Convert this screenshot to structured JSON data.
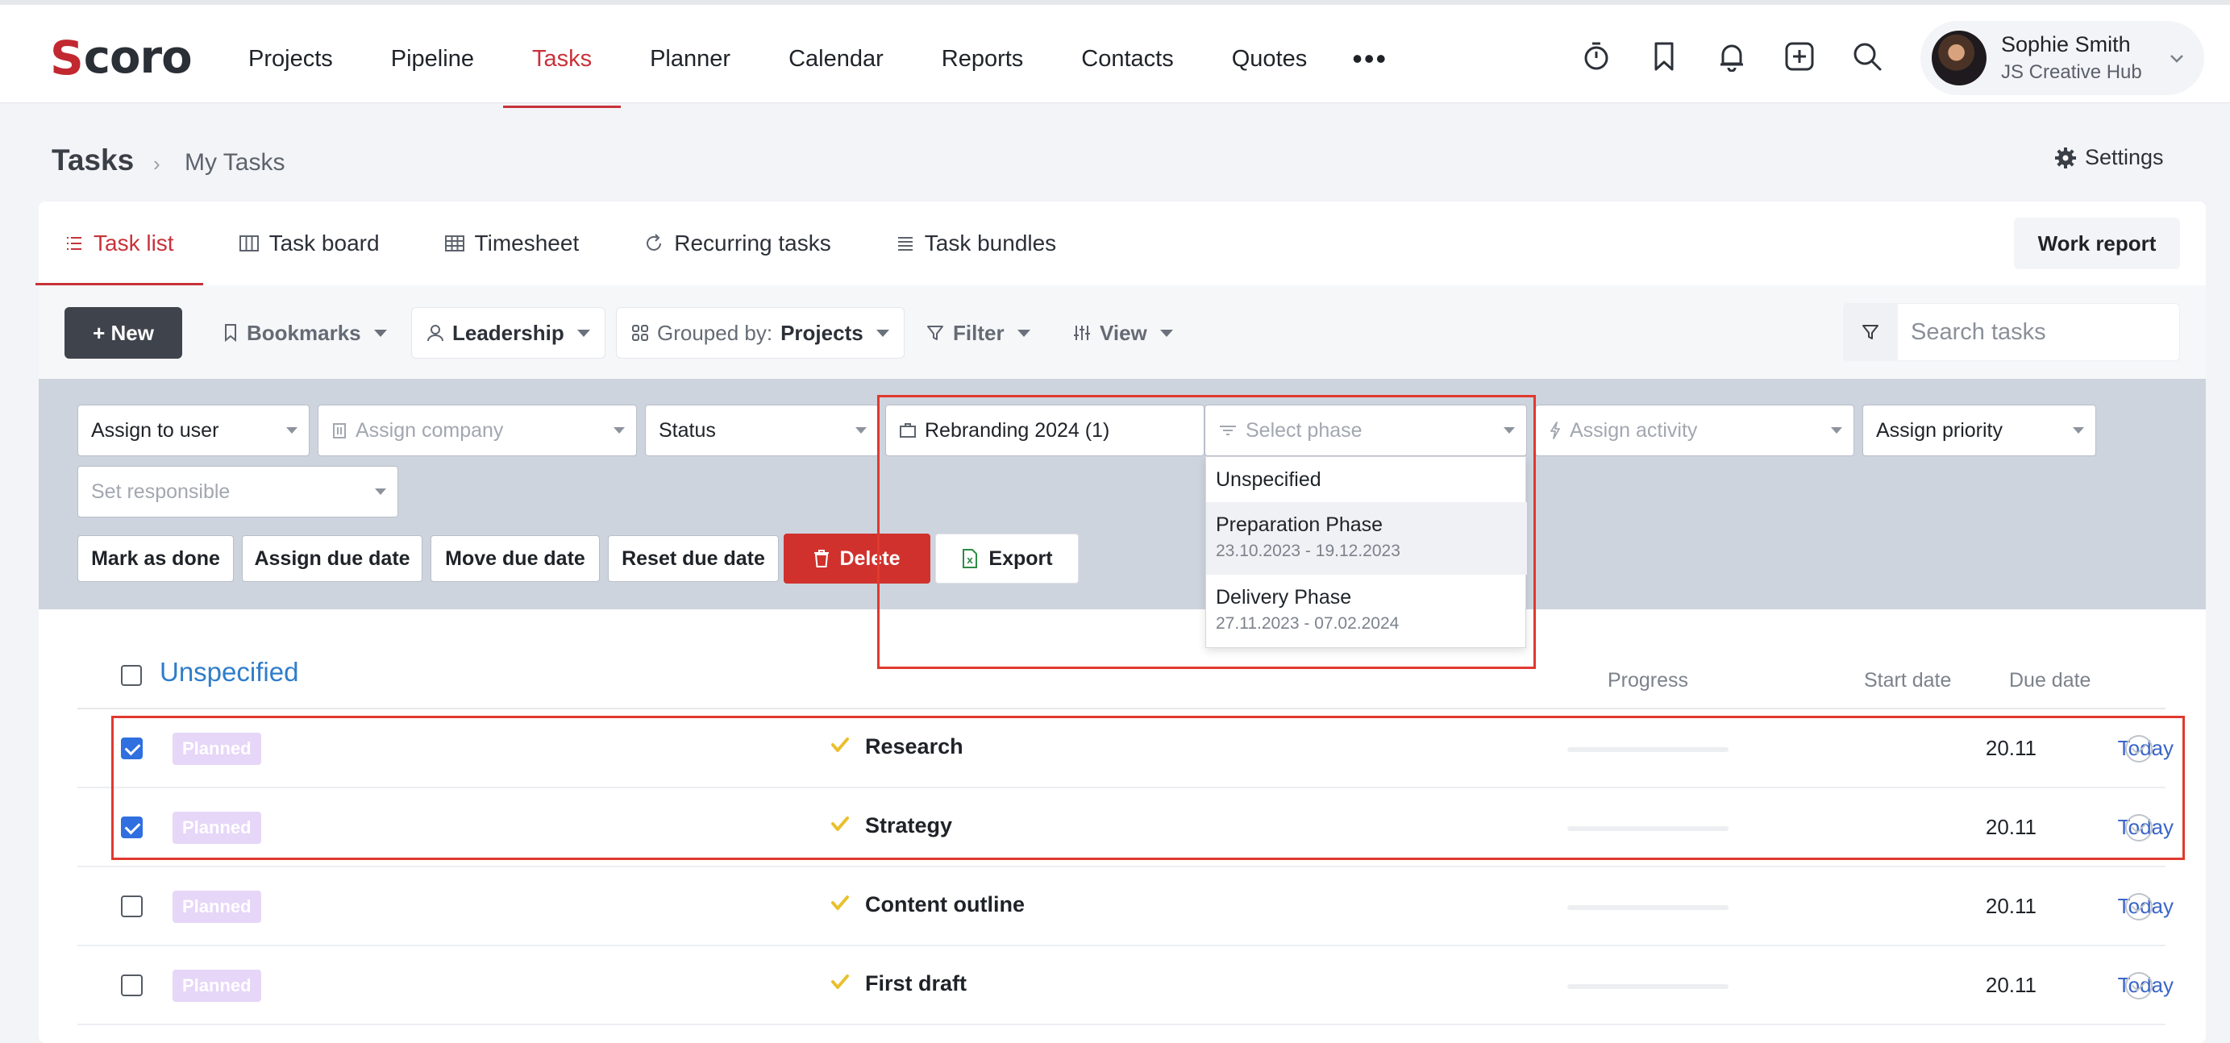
{
  "app": {
    "logo_first": "S",
    "logo_rest": "coro"
  },
  "nav": {
    "items": [
      {
        "label": "Projects",
        "active": false
      },
      {
        "label": "Pipeline",
        "active": false
      },
      {
        "label": "Tasks",
        "active": true
      },
      {
        "label": "Planner",
        "active": false
      },
      {
        "label": "Calendar",
        "active": false
      },
      {
        "label": "Reports",
        "active": false
      },
      {
        "label": "Contacts",
        "active": false
      },
      {
        "label": "Quotes",
        "active": false
      }
    ],
    "more": "•••",
    "icons": [
      "timer-icon",
      "bookmark-icon",
      "bell-icon",
      "add-square-icon",
      "search-icon"
    ]
  },
  "user": {
    "name": "Sophie Smith",
    "company": "JS Creative Hub"
  },
  "breadcrumb": {
    "title": "Tasks",
    "separator": "›",
    "current": "My Tasks"
  },
  "settings_label": "Settings",
  "tabs": [
    {
      "label": "Task list",
      "active": true,
      "icon": "list-icon"
    },
    {
      "label": "Task board",
      "active": false,
      "icon": "board-icon"
    },
    {
      "label": "Timesheet",
      "active": false,
      "icon": "grid-icon"
    },
    {
      "label": "Recurring tasks",
      "active": false,
      "icon": "refresh-icon"
    },
    {
      "label": "Task bundles",
      "active": false,
      "icon": "lines-icon"
    }
  ],
  "work_report": "Work report",
  "toolbar": {
    "new": "+ New",
    "bookmarks": "Bookmarks",
    "leadership": "Leadership",
    "grouped_prefix": "Grouped by:",
    "grouped_value": "Projects",
    "filter": "Filter",
    "view": "View",
    "search_placeholder": "Search tasks"
  },
  "bulk": {
    "assign_user": "Assign to user",
    "assign_company": "Assign company",
    "status": "Status",
    "project": "Rebranding 2024 (1)",
    "phase_placeholder": "Select phase",
    "assign_activity": "Assign activity",
    "assign_priority": "Assign priority",
    "set_responsible": "Set responsible",
    "actions": {
      "mark_done": "Mark as done",
      "assign_due": "Assign due date",
      "move_due": "Move due date",
      "reset_due": "Reset due date",
      "delete": "Delete",
      "export": "Export"
    }
  },
  "phase_menu": [
    {
      "title": "Unspecified",
      "dates": ""
    },
    {
      "title": "Preparation Phase",
      "dates": "23.10.2023 - 19.12.2023",
      "highlighted": true
    },
    {
      "title": "Delivery Phase",
      "dates": "27.11.2023 - 07.02.2024"
    }
  ],
  "group": {
    "title": "Unspecified",
    "columns": {
      "progress": "Progress",
      "start": "Start date",
      "due": "Due date"
    }
  },
  "tasks": [
    {
      "checked": true,
      "status": "Planned",
      "name": "Research",
      "progress": 0,
      "start": "20.11",
      "due": "Today"
    },
    {
      "checked": true,
      "status": "Planned",
      "name": "Strategy",
      "progress": 0,
      "start": "20.11",
      "due": "Today"
    },
    {
      "checked": false,
      "status": "Planned",
      "name": "Content outline",
      "progress": 0,
      "start": "20.11",
      "due": "Today"
    },
    {
      "checked": false,
      "status": "Planned",
      "name": "First draft",
      "progress": 0,
      "start": "20.11",
      "due": "Today"
    }
  ],
  "colors": {
    "accent": "#c8323a",
    "link": "#2f7dc9",
    "danger": "#d0312d",
    "highlight": "#e0392f",
    "badge": "#e6d6f7"
  }
}
